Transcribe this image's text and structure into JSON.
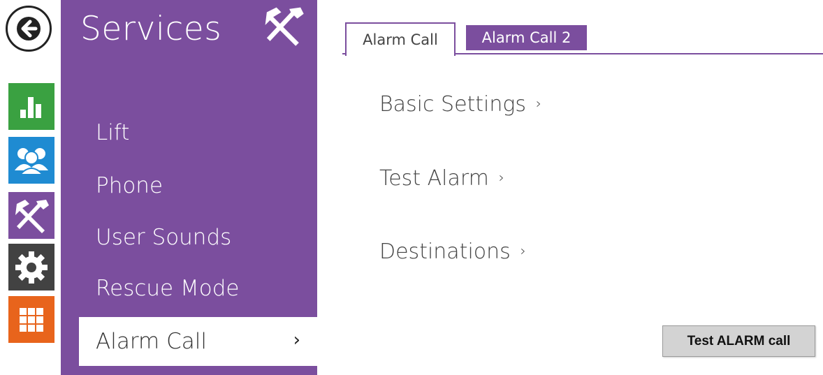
{
  "sidebar": {
    "title": "Services",
    "title_icon": "tools-icon",
    "items": [
      {
        "label": "Lift"
      },
      {
        "label": "Phone"
      },
      {
        "label": "User Sounds"
      },
      {
        "label": "Rescue Mode"
      }
    ],
    "active_item": {
      "label": "Alarm Call",
      "chevron": "›"
    }
  },
  "rail": {
    "back_icon": "back-arrow-icon",
    "tiles": [
      {
        "icon": "stats-icon",
        "color": "#3aa141"
      },
      {
        "icon": "users-icon",
        "color": "#1f8bd2"
      },
      {
        "icon": "tools-icon",
        "color": "#7b4e9e"
      },
      {
        "icon": "gear-icon",
        "color": "#424242"
      },
      {
        "icon": "grid-icon",
        "color": "#e8641c"
      }
    ]
  },
  "tabs": [
    {
      "label": "Alarm Call",
      "active": true
    },
    {
      "label": "Alarm Call 2",
      "active": false
    }
  ],
  "content": {
    "links": [
      {
        "label": "Basic Settings",
        "chevron": "›"
      },
      {
        "label": "Test Alarm",
        "chevron": "›"
      },
      {
        "label": "Destinations",
        "chevron": "›"
      }
    ],
    "test_button_label": "Test ALARM call"
  },
  "colors": {
    "accent": "#7b4e9e"
  }
}
